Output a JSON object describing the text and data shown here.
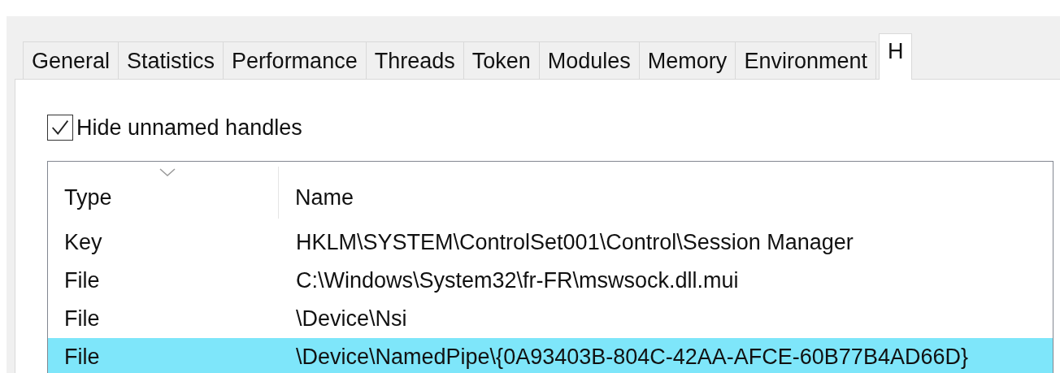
{
  "tabs": [
    {
      "label": "General",
      "selected": false
    },
    {
      "label": "Statistics",
      "selected": false
    },
    {
      "label": "Performance",
      "selected": false
    },
    {
      "label": "Threads",
      "selected": false
    },
    {
      "label": "Token",
      "selected": false
    },
    {
      "label": "Modules",
      "selected": false
    },
    {
      "label": "Memory",
      "selected": false
    },
    {
      "label": "Environment",
      "selected": false
    },
    {
      "label": "H",
      "selected": true
    }
  ],
  "hide_unnamed_handles": {
    "label": "Hide unnamed handles",
    "checked": true
  },
  "table": {
    "columns": [
      {
        "label": "Type",
        "sorted": true
      },
      {
        "label": "Name",
        "sorted": false
      }
    ],
    "rows": [
      {
        "type": "Key",
        "name": "HKLM\\SYSTEM\\ControlSet001\\Control\\Session Manager",
        "selected": false
      },
      {
        "type": "File",
        "name": "C:\\Windows\\System32\\fr-FR\\mswsock.dll.mui",
        "selected": false
      },
      {
        "type": "File",
        "name": "\\Device\\Nsi",
        "selected": false
      },
      {
        "type": "File",
        "name": "\\Device\\NamedPipe\\{0A93403B-804C-42AA-AFCE-60B77B4AD66D}",
        "selected": true
      }
    ]
  }
}
